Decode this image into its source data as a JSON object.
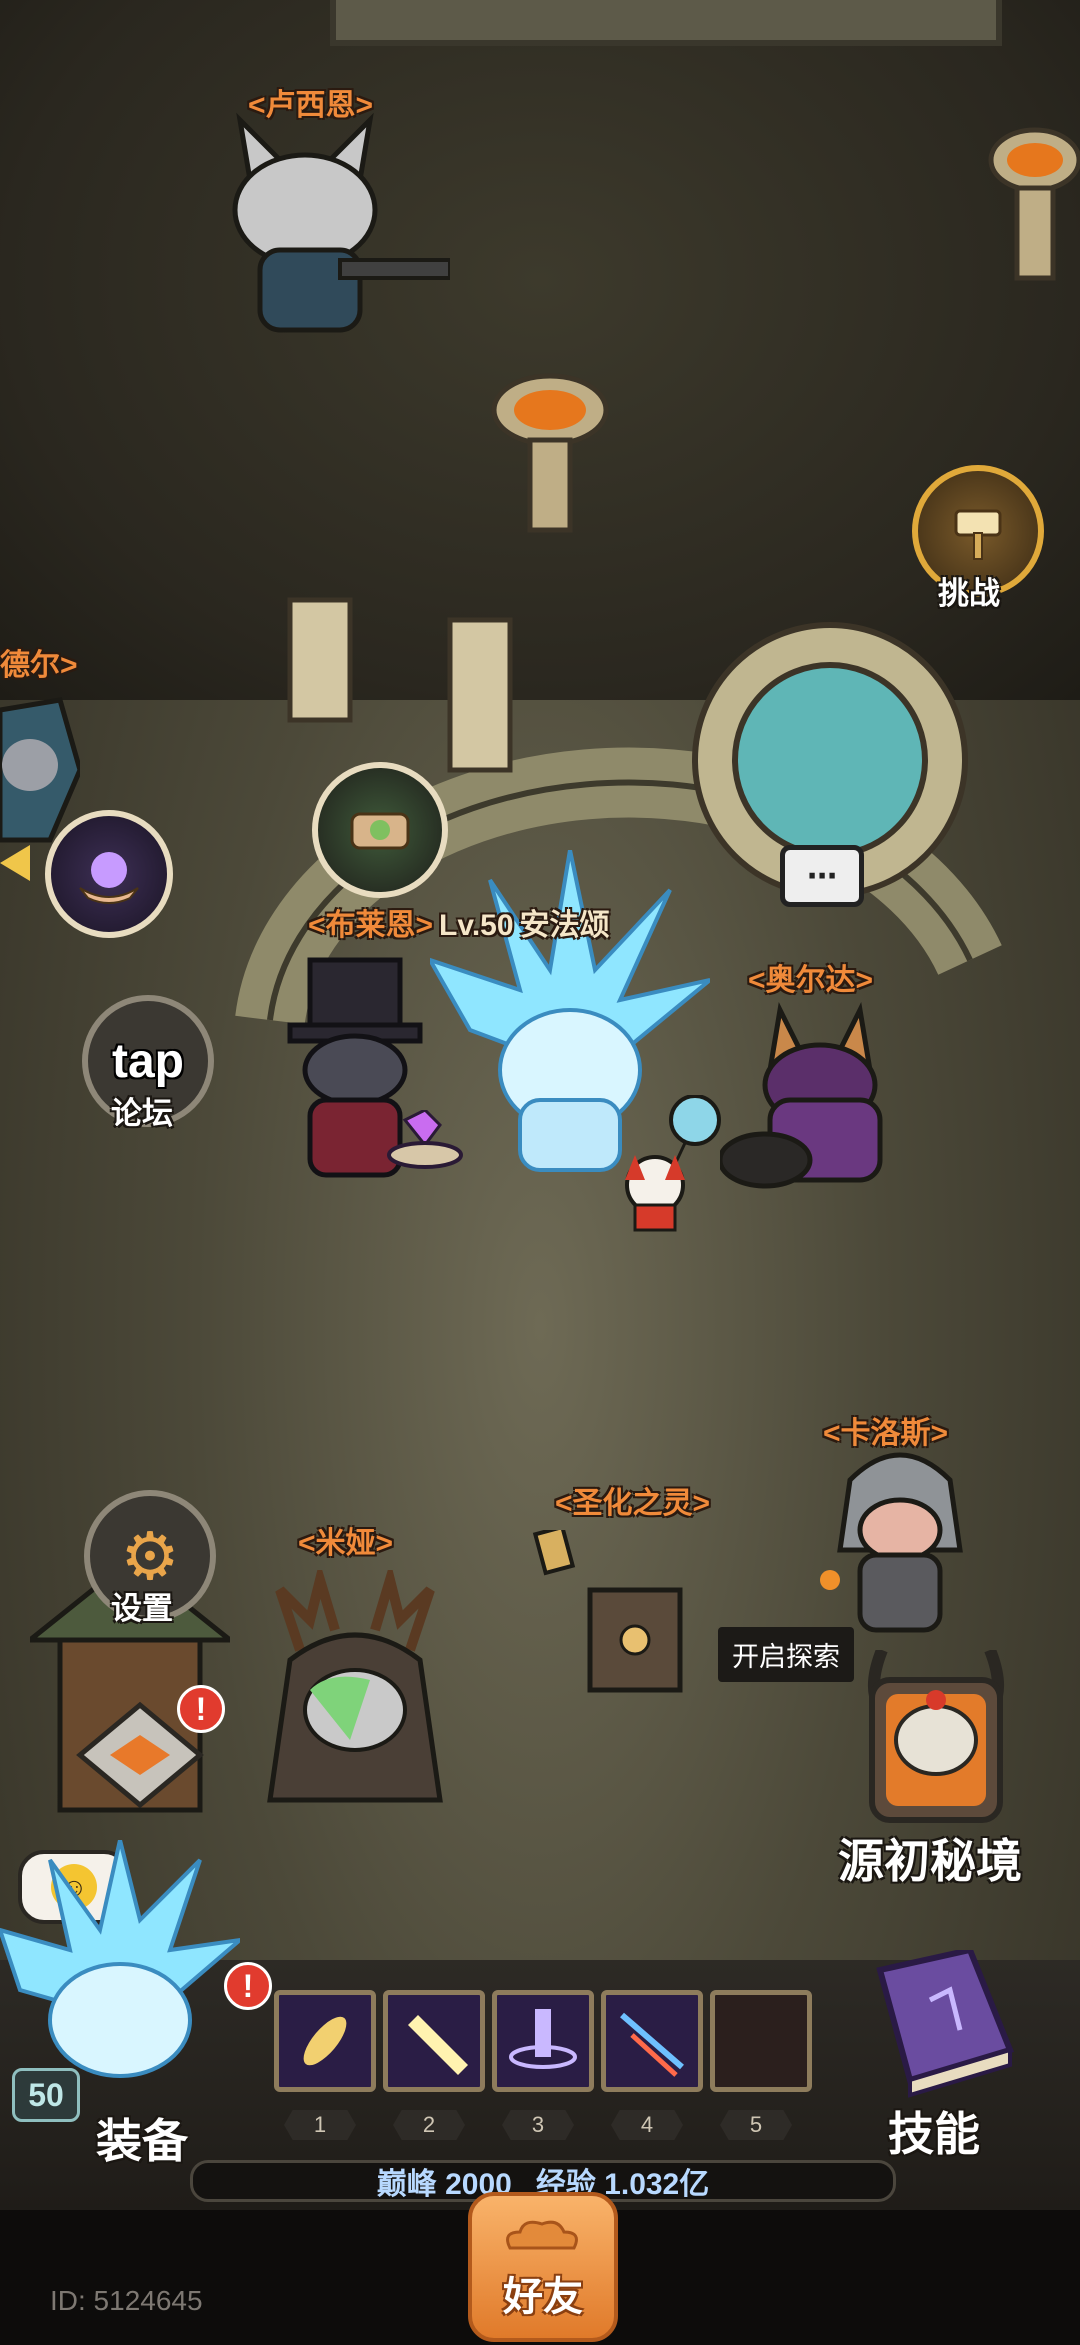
{
  "npcs": {
    "lucien": "<卢西恩>",
    "deer": "德尔>",
    "blaine": "<布莱恩>",
    "player_level": "Lv.50",
    "player_name": "安法颂",
    "orda": "<奥尔达>",
    "carlos": "<卡洛斯>",
    "holy_spirit": "<圣化之灵>",
    "mia": "<米娅>"
  },
  "buttons": {
    "challenge": "挑战",
    "forum_logo": "tap",
    "forum": "论坛",
    "settings": "设置",
    "origin_realm": "源初秘境",
    "equipment": "装备",
    "skills": "技能",
    "friends": "好友"
  },
  "tooltip": {
    "explore": "开启探索"
  },
  "badges": {
    "alert": "!",
    "level": "50"
  },
  "skill_slots": [
    {
      "number": "1",
      "filled": true,
      "color": "#f2d070"
    },
    {
      "number": "2",
      "filled": true,
      "color": "#fff3b0"
    },
    {
      "number": "3",
      "filled": true,
      "color": "#c9b8ff"
    },
    {
      "number": "4",
      "filled": true,
      "color": "#6ec0ff"
    },
    {
      "number": "5",
      "filled": false,
      "color": ""
    }
  ],
  "status": {
    "peak_label": "巅峰",
    "peak_value": "2000",
    "exp_label": "经验",
    "exp_value": "1.032亿"
  },
  "footer": {
    "player_id": "ID: 5124645"
  },
  "colors": {
    "name_tag": "#f08a3a",
    "accent_orange": "#e07a2a",
    "ice": "#8fe6ff"
  }
}
